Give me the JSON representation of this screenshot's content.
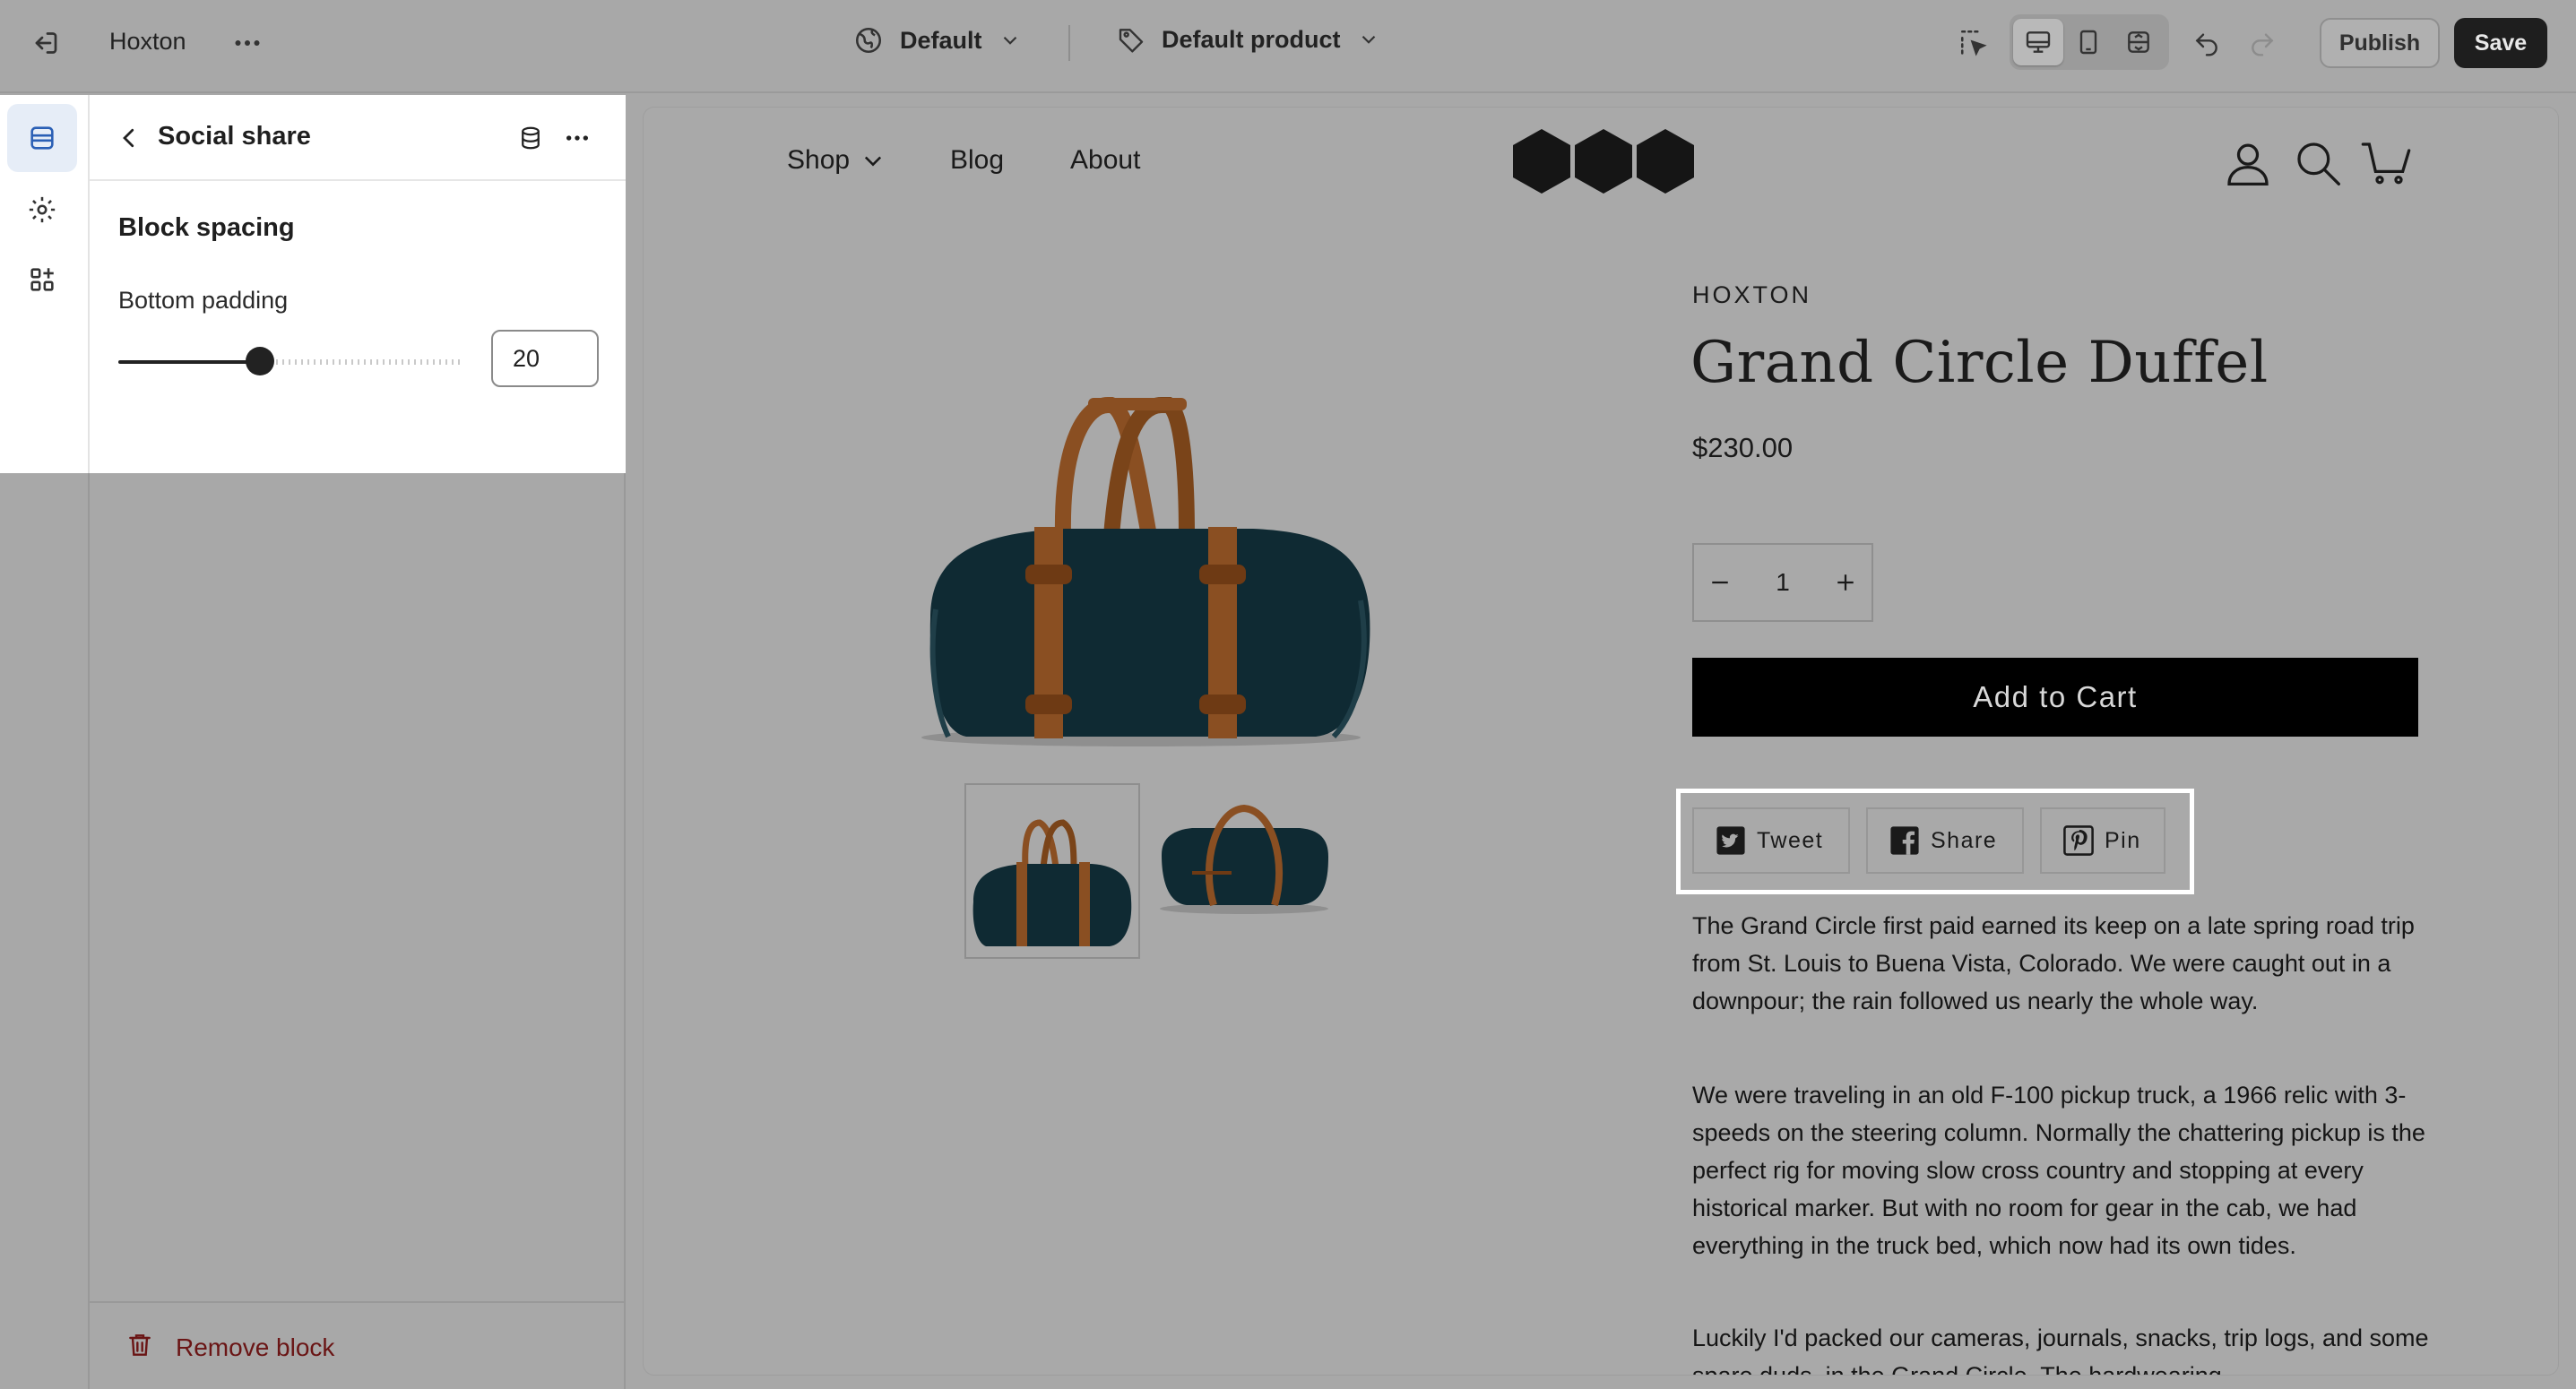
{
  "topbar": {
    "exit_icon": "exit-icon",
    "store_name": "Hoxton",
    "more_icon": "ellipsis-icon",
    "theme_selector": "Default",
    "template_selector": "Default product",
    "publish_label": "Publish",
    "save_label": "Save"
  },
  "rail": {
    "items": [
      "sections-icon",
      "settings-gear-icon",
      "apps-icon"
    ]
  },
  "panel": {
    "title": "Social share",
    "section_title": "Block spacing",
    "field_label": "Bottom padding",
    "slider_value": 20,
    "slider_fraction": 0.41,
    "input_value": "20",
    "remove_label": "Remove block"
  },
  "store": {
    "nav": [
      "Shop",
      "Blog",
      "About"
    ],
    "vendor": "HOXTON",
    "product_title": "Grand Circle Duffel",
    "price": "$230.00",
    "quantity": "1",
    "add_to_cart": "Add to Cart",
    "share": [
      "Tweet",
      "Share",
      "Pin"
    ],
    "description": [
      "The Grand Circle first paid earned its keep on a late spring road trip from St. Louis to Buena Vista, Colorado. We were caught out in a downpour; the rain followed us nearly the whole way.",
      "We were traveling in an old F-100 pickup truck, a 1966 relic with 3-speeds on the steering column. Normally the chattering pickup is the perfect rig for moving slow cross country and stopping at every historical marker. But with no room for gear in the cab, we had everything in the truck bed, which now had its own tides.",
      "Luckily I'd packed our cameras, journals, snacks, trip logs, and some spare duds, in the Grand Circle. The hardwearing"
    ]
  },
  "colors": {
    "overlay": "#a8a8a8",
    "panel_bg": "#ffffff",
    "accent_active": "#e6edf7",
    "remove_text": "#6a1515",
    "bag_body": "#0f2a33",
    "bag_leather": "#8a4f22"
  }
}
